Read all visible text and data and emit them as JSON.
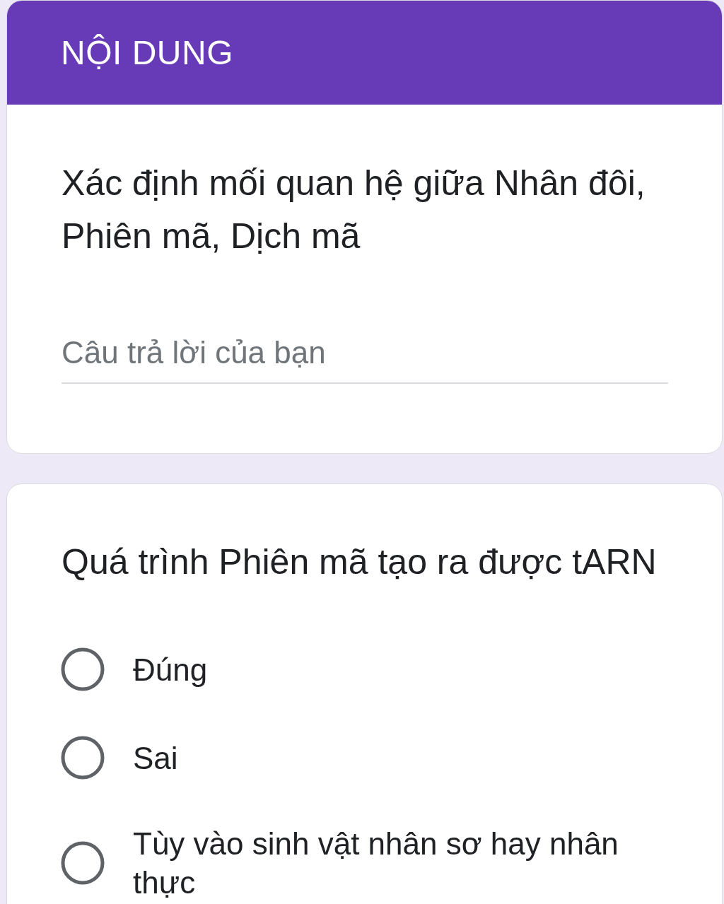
{
  "header": {
    "title": "NỘI DUNG"
  },
  "questions": [
    {
      "kind": "text",
      "title": "Xác định mối quan hệ giữa Nhân đôi, Phiên mã, Dịch mã",
      "answer": {
        "placeholder": "Câu trả lời của bạn"
      }
    },
    {
      "kind": "choice",
      "title": "Quá trình Phiên mã tạo ra được tARN",
      "options": [
        {
          "label": "Đúng",
          "selected": false
        },
        {
          "label": "Sai",
          "selected": false
        },
        {
          "label": "Tùy vào sinh vật nhân sơ hay nhân thực",
          "selected": false
        }
      ]
    }
  ]
}
